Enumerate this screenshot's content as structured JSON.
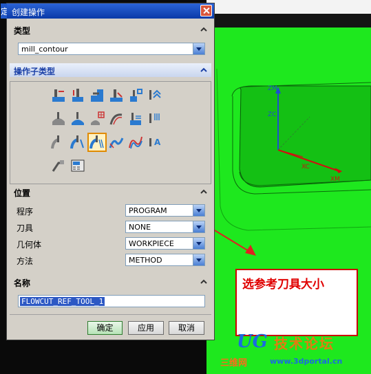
{
  "dialog": {
    "title": "创建操作",
    "sections": {
      "type": "类型",
      "subtype": "操作子类型",
      "location": "位置",
      "name": "名称"
    },
    "type_value": "mill_contour",
    "location_rows": [
      {
        "label": "程序",
        "value": "PROGRAM"
      },
      {
        "label": "刀具",
        "value": "NONE"
      },
      {
        "label": "几何体",
        "value": "WORKPIECE"
      },
      {
        "label": "方法",
        "value": "METHOD"
      }
    ],
    "name_value": "FLOWCUT_REF_TOOL_1",
    "buttons": {
      "ok": "确定",
      "apply": "应用",
      "cancel": "取消"
    },
    "selected_subtype_icon": "flowcut-ref-tool-icon"
  },
  "viewport": {
    "axis_labels": {
      "zm": "ZM",
      "zc": "ZC",
      "xc": "XC",
      "xm": "XM"
    },
    "colors": {
      "part": "#1ee81e",
      "part_dark": "#11b011",
      "axis_blue": "#1d4fd0",
      "axis_red": "#d01010"
    }
  },
  "annotation": {
    "text": "选参考刀具大小"
  },
  "watermark": {
    "logo": "UG",
    "title": "技术论坛",
    "sub": "三维网",
    "url": "www.3dportal.cn"
  },
  "cut_off_menu_char": "定"
}
